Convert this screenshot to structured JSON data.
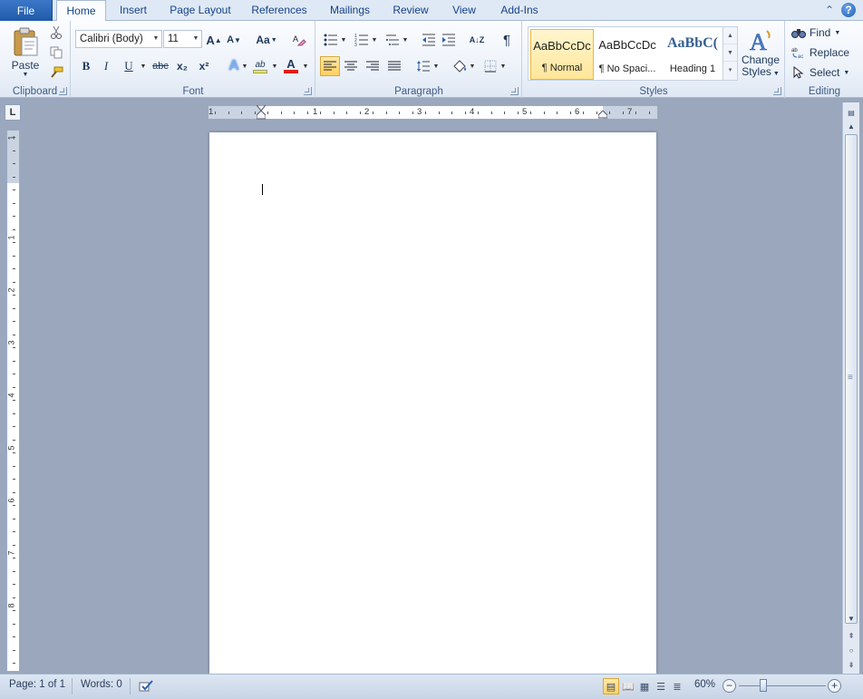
{
  "tabs": {
    "file": "File",
    "items": [
      "Home",
      "Insert",
      "Page Layout",
      "References",
      "Mailings",
      "Review",
      "View",
      "Add-Ins"
    ],
    "active": "Home"
  },
  "clipboard": {
    "label": "Clipboard",
    "paste": "Paste"
  },
  "font": {
    "label": "Font",
    "family": "Calibri (Body)",
    "size": "11",
    "bold": "B",
    "italic": "I",
    "underline": "U",
    "strike": "abc",
    "subscript": "x₂",
    "superscript": "x²",
    "grow": "A",
    "shrink": "A",
    "case": "Aa",
    "font_color_letter": "A",
    "highlight_letter": "ab",
    "effects_letter": "A"
  },
  "paragraph": {
    "label": "Paragraph",
    "pilcrow": "¶",
    "sort": "A↓Z"
  },
  "styles": {
    "label": "Styles",
    "items": [
      {
        "sample": "AaBbCcDc",
        "name": "¶ Normal",
        "selected": true
      },
      {
        "sample": "AaBbCcDc",
        "name": "¶ No Spaci...",
        "selected": false
      },
      {
        "sample": "AaBbC(",
        "name": "Heading 1",
        "selected": false
      }
    ],
    "change_styles_line1": "Change",
    "change_styles_line2": "Styles"
  },
  "editing": {
    "label": "Editing",
    "find": "Find",
    "replace": "Replace",
    "select": "Select"
  },
  "ruler": {
    "h_numbers": [
      "1",
      "1",
      "2",
      "3",
      "4",
      "5",
      "6",
      "7"
    ],
    "v_numbers": [
      "1",
      "1",
      "2",
      "3",
      "4",
      "5",
      "6",
      "7",
      "8"
    ]
  },
  "status": {
    "page": "Page: 1 of 1",
    "words": "Words: 0",
    "zoom": "60%",
    "zoom_fraction": 0.6
  },
  "colors": {
    "file_tab": "#2a64b4",
    "highlight": "#ffff00",
    "font_color": "#e01b1b",
    "selected_style": "#ffe69a"
  }
}
